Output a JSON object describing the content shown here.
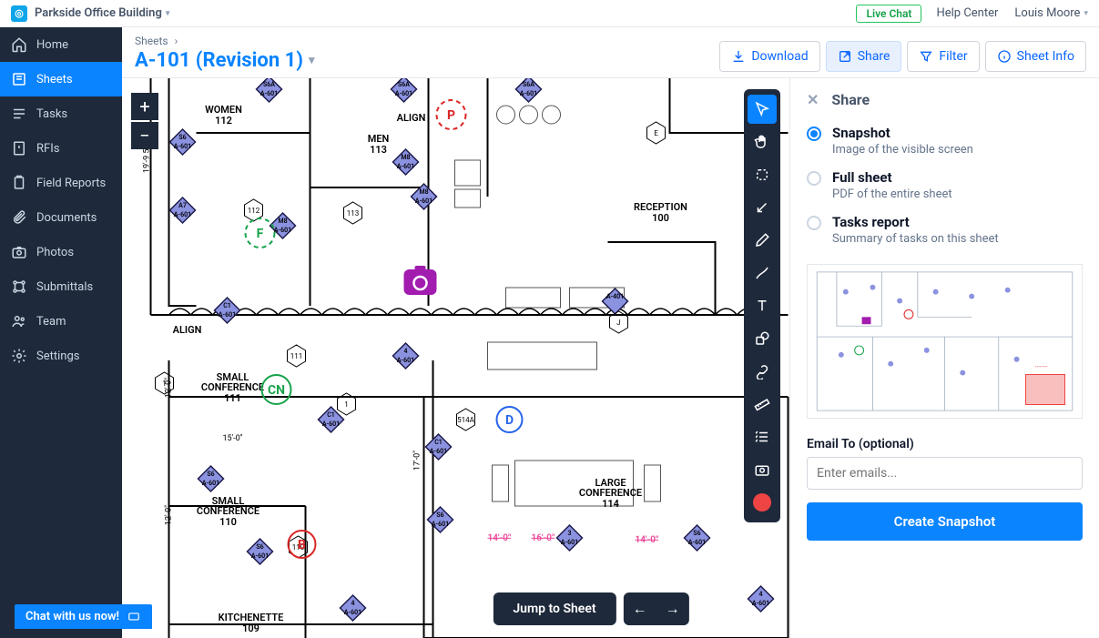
{
  "topbar": {
    "project": "Parkside Office Building",
    "live_chat": "Live Chat",
    "help": "Help Center",
    "user": "Louis Moore"
  },
  "sidebar": {
    "items": [
      {
        "label": "Home"
      },
      {
        "label": "Sheets"
      },
      {
        "label": "Tasks"
      },
      {
        "label": "RFIs"
      },
      {
        "label": "Field Reports"
      },
      {
        "label": "Documents"
      },
      {
        "label": "Photos"
      },
      {
        "label": "Submittals"
      },
      {
        "label": "Team"
      },
      {
        "label": "Settings"
      }
    ]
  },
  "chat_btn": "Chat with us now!",
  "header": {
    "crumb": "Sheets",
    "crumb_sep": "›",
    "title": "A-101 (Revision 1)"
  },
  "toolbar": {
    "download": "Download",
    "share": "Share",
    "filter": "Filter",
    "sheetinfo": "Sheet Info"
  },
  "jump": {
    "label": "Jump to Sheet"
  },
  "share": {
    "title": "Share",
    "options": [
      {
        "title": "Snapshot",
        "desc": "Image of the visible screen"
      },
      {
        "title": "Full sheet",
        "desc": "PDF of the entire sheet"
      },
      {
        "title": "Tasks report",
        "desc": "Summary of tasks on this sheet"
      }
    ],
    "email_label": "Email To (optional)",
    "email_placeholder": "Enter emails...",
    "submit": "Create Snapshot"
  },
  "rooms": {
    "women": {
      "name": "WOMEN",
      "num": "112"
    },
    "men": {
      "name": "MEN",
      "num": "113"
    },
    "reception": {
      "name": "RECEPTION",
      "num": "100"
    },
    "small_conf_111": {
      "name": "SMALL",
      "name2": "CONFERENCE",
      "num": "111"
    },
    "small_conf_110": {
      "name": "SMALL",
      "name2": "CONFERENCE",
      "num": "110"
    },
    "large_conf": {
      "name": "LARGE",
      "name2": "CONFERENCE",
      "num": "114"
    },
    "kitchenette": {
      "name": "KITCHENETTE",
      "num": "109"
    }
  },
  "dims": {
    "d1": "19'-9 5/8\"",
    "d2": "12'-0\"",
    "d3": "15'-0\"",
    "d4": "12'-0\"",
    "d5": "17'-0\"",
    "d6": "16'-0\"",
    "d7": "14'-0\""
  },
  "labels": {
    "align1": "ALIGN",
    "align2": "ALIGN",
    "s6": "S6",
    "s6a": "S6A",
    "a7": "A7",
    "a601": "A-601",
    "m8": "M8",
    "c1": "C1",
    "a401": "A-401",
    "num4": "4",
    "num3": "3",
    "num112": "112",
    "num113": "113",
    "num110": "110",
    "num111": "111",
    "num514a": "514A",
    "numE": "E",
    "numJ": "J",
    "num1": "1"
  },
  "markers": {
    "F": "F",
    "P": "P",
    "CN": "CN",
    "D": "D",
    "B": "B"
  }
}
